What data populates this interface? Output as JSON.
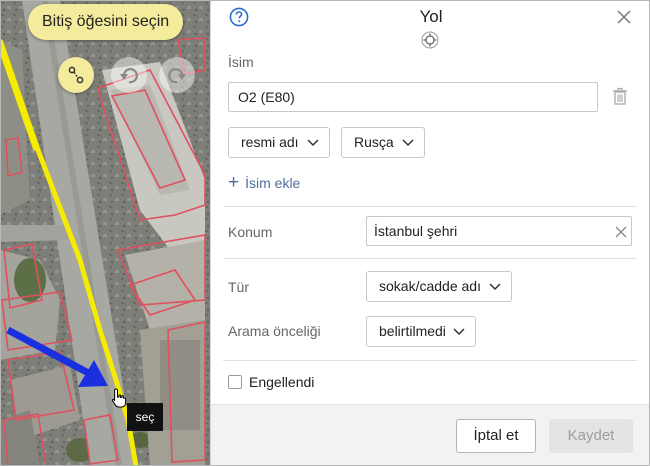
{
  "map": {
    "hint": "Bitiş öğesini seçin",
    "tooltip": "seç",
    "buttons": [
      {
        "name": "route-point-icon"
      },
      {
        "name": "undo-icon"
      },
      {
        "name": "redo-icon"
      }
    ]
  },
  "panel": {
    "title": "Yol",
    "name_section": {
      "label": "İsim",
      "value": "O2 (E80)",
      "name_type": "resmi adı",
      "language": "Rusça",
      "add_name": "İsim ekle"
    },
    "location": {
      "label": "Konum",
      "value": "İstanbul şehri"
    },
    "type": {
      "label": "Tür",
      "value": "sokak/cadde adı"
    },
    "search_priority": {
      "label": "Arama önceliği",
      "value": "belirtilmedi"
    },
    "blocked": {
      "label": "Engellendi",
      "checked": false
    },
    "buttons": {
      "cancel": "İptal et",
      "save": "Kaydet"
    }
  },
  "colors": {
    "road_highlight": "#f5ec00",
    "boundary": "#e0505e",
    "hint_bg": "#f5eb9c",
    "accent": "#2a6fd0",
    "arrow": "#1a2fe0"
  }
}
